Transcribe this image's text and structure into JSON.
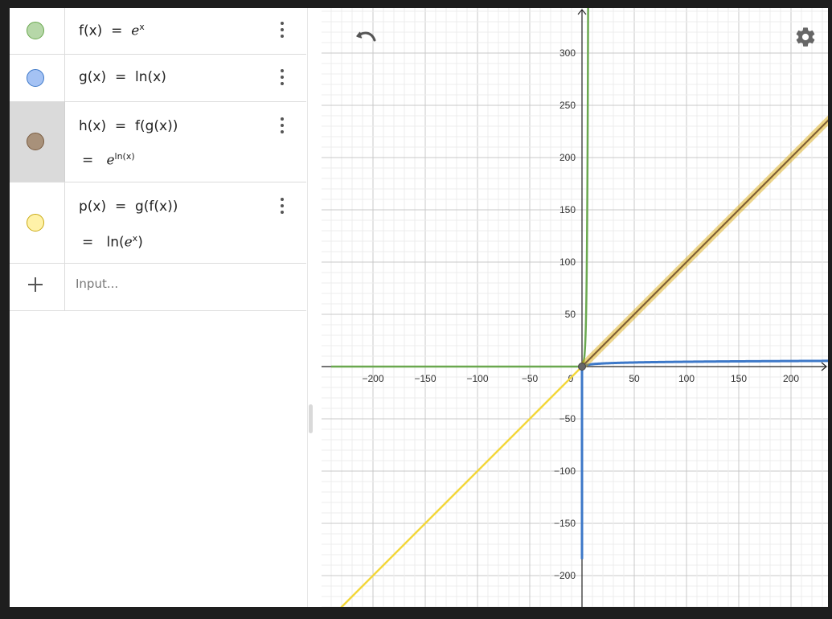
{
  "colors": {
    "f": "#6aa84f",
    "f_fill": "#b6d7a8",
    "g": "#3d78c8",
    "g_fill": "#a4c2f4",
    "h": "#7a5c40",
    "h_fill": "#a8917a",
    "p": "#f3d73b",
    "p_fill": "#fff2a8",
    "grid_minor": "#ececec",
    "grid_major": "#c8c8c8",
    "axis": "#222222"
  },
  "algebra": {
    "rows": [
      {
        "id": "f",
        "lhs": "f(x)",
        "eq": "=",
        "rhs_base": "e",
        "rhs_sup": "x"
      },
      {
        "id": "g",
        "lhs": "g(x)",
        "eq": "=",
        "rhs": "ln(x)"
      },
      {
        "id": "h",
        "lhs": "h(x)",
        "eq": "=",
        "rhs": "f(g(x))",
        "result_eq": "=",
        "result_base": "e",
        "result_sup": "ln(x)"
      },
      {
        "id": "p",
        "lhs": "p(x)",
        "eq": "=",
        "rhs": "g(f(x))",
        "result_eq": "=",
        "result_pre": "ln(",
        "result_base": "e",
        "result_sup": "x",
        "result_post": ")"
      }
    ],
    "input_placeholder": "Input..."
  },
  "icons": {
    "undo": "undo-icon",
    "settings": "gear-icon",
    "menu": "kebab-menu-icon",
    "add": "plus-icon"
  },
  "graph": {
    "x_ticks": [
      "−200",
      "−150",
      "−100",
      "−50",
      "0",
      "50",
      "100",
      "150",
      "200"
    ],
    "y_ticks": [
      "300",
      "250",
      "200",
      "150",
      "100",
      "50",
      "−50",
      "−100",
      "−150",
      "−200"
    ],
    "x_range": [
      -240,
      240
    ],
    "y_range": [
      -230,
      345
    ]
  }
}
